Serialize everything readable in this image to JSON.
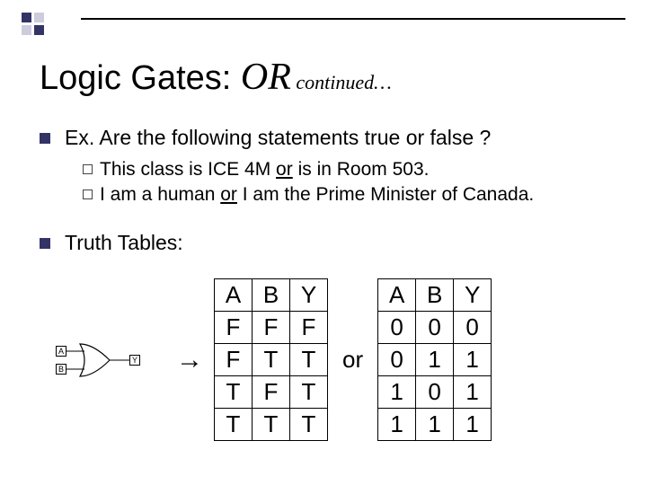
{
  "header": {
    "plain": "Logic Gates:  ",
    "italic": "OR",
    "sub": " continued…"
  },
  "ex_bullet": "Ex. Are the following statements true or false ?",
  "sub1_a": "This class is ICE 4M ",
  "sub1_or": "or",
  "sub1_b": " is in Room 503.",
  "sub2_a": "I am a human ",
  "sub2_or": "or",
  "sub2_b": " I am the Prime Minister of Canada.",
  "truth_bullet": "Truth Tables:",
  "gate": {
    "A": "A",
    "B": "B",
    "Y": "Y"
  },
  "arrow": "→",
  "or_sep": "or",
  "table_tf": {
    "headers": [
      "A",
      "B",
      "Y"
    ],
    "rows": [
      [
        "F",
        "F",
        "F"
      ],
      [
        "F",
        "T",
        "T"
      ],
      [
        "T",
        "F",
        "T"
      ],
      [
        "T",
        "T",
        "T"
      ]
    ]
  },
  "table_01": {
    "headers": [
      "A",
      "B",
      "Y"
    ],
    "rows": [
      [
        "0",
        "0",
        "0"
      ],
      [
        "0",
        "1",
        "1"
      ],
      [
        "1",
        "0",
        "1"
      ],
      [
        "1",
        "1",
        "1"
      ]
    ]
  },
  "chart_data": {
    "type": "table",
    "title": "OR gate truth tables",
    "tables": [
      {
        "columns": [
          "A",
          "B",
          "Y"
        ],
        "rows": [
          [
            "F",
            "F",
            "F"
          ],
          [
            "F",
            "T",
            "T"
          ],
          [
            "T",
            "F",
            "T"
          ],
          [
            "T",
            "T",
            "T"
          ]
        ]
      },
      {
        "columns": [
          "A",
          "B",
          "Y"
        ],
        "rows": [
          [
            "0",
            "0",
            "0"
          ],
          [
            "0",
            "1",
            "1"
          ],
          [
            "1",
            "0",
            "1"
          ],
          [
            "1",
            "1",
            "1"
          ]
        ]
      }
    ]
  }
}
